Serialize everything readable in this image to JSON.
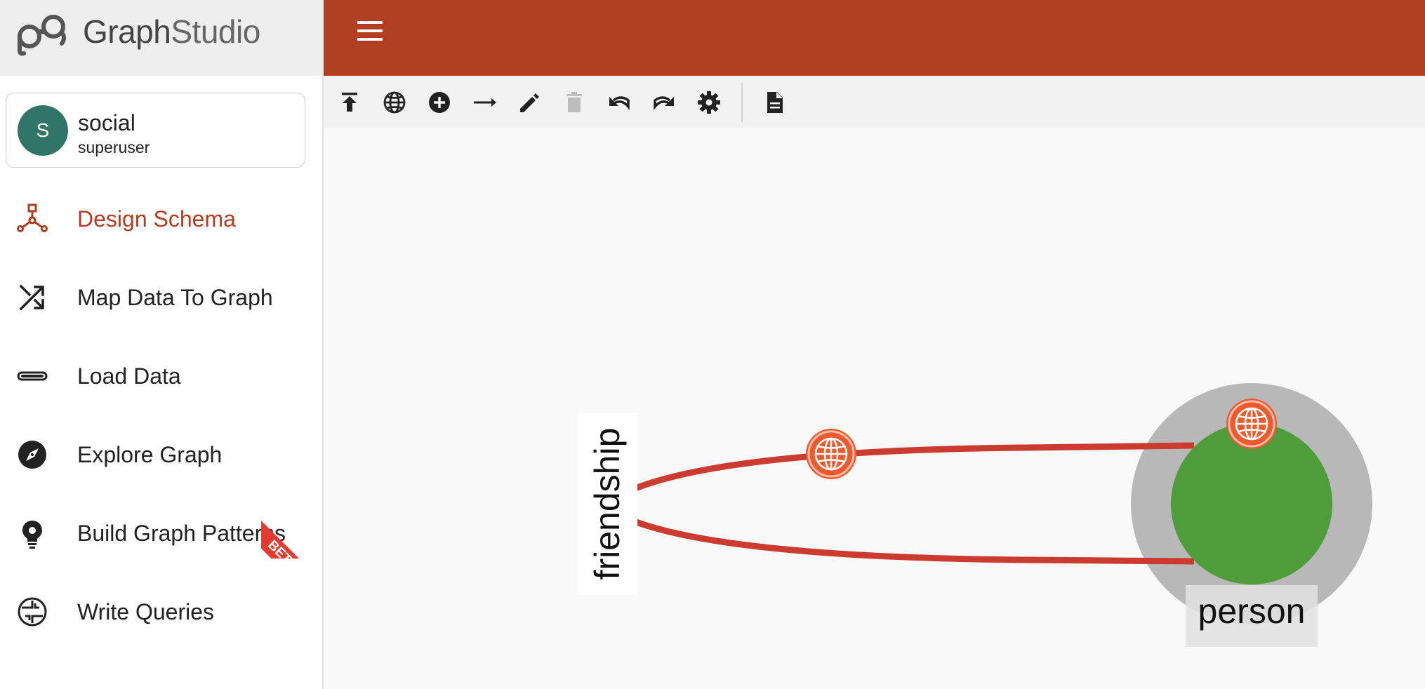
{
  "app": {
    "name_bold": "Graph",
    "name_light": "Studio"
  },
  "user": {
    "initial": "S",
    "name": "social",
    "role": "superuser"
  },
  "nav": {
    "items": [
      {
        "label": "Design Schema",
        "icon": "schema-icon",
        "active": true
      },
      {
        "label": "Map Data To Graph",
        "icon": "shuffle-icon",
        "active": false
      },
      {
        "label": "Load Data",
        "icon": "progress-icon",
        "active": false
      },
      {
        "label": "Explore Graph",
        "icon": "compass-icon",
        "active": false
      },
      {
        "label": "Build Graph Patterns",
        "icon": "lightbulb-icon",
        "active": false
      },
      {
        "label": "Write Queries",
        "icon": "query-icon",
        "active": false
      }
    ],
    "beta_label": "BETA"
  },
  "toolbar": {
    "buttons": [
      {
        "icon": "publish-icon",
        "enabled": true
      },
      {
        "icon": "globe-icon",
        "enabled": true
      },
      {
        "icon": "add-vertex-icon",
        "enabled": true
      },
      {
        "icon": "add-edge-icon",
        "enabled": true
      },
      {
        "icon": "edit-icon",
        "enabled": true
      },
      {
        "icon": "delete-icon",
        "enabled": false
      },
      {
        "icon": "undo-icon",
        "enabled": true
      },
      {
        "icon": "redo-icon",
        "enabled": true
      },
      {
        "icon": "settings-icon",
        "enabled": true
      },
      {
        "icon": "document-icon",
        "enabled": true
      }
    ]
  },
  "schema": {
    "vertex_label": "person",
    "edge_label": "friendship"
  },
  "colors": {
    "header": "#b13f21",
    "active_nav": "#b23d21",
    "vertex": "#4f9c3a",
    "vertex_halo": "#b8b8b8",
    "edge": "#cc3b30",
    "globe_marker": "#ee5a2e",
    "avatar": "#317566"
  }
}
